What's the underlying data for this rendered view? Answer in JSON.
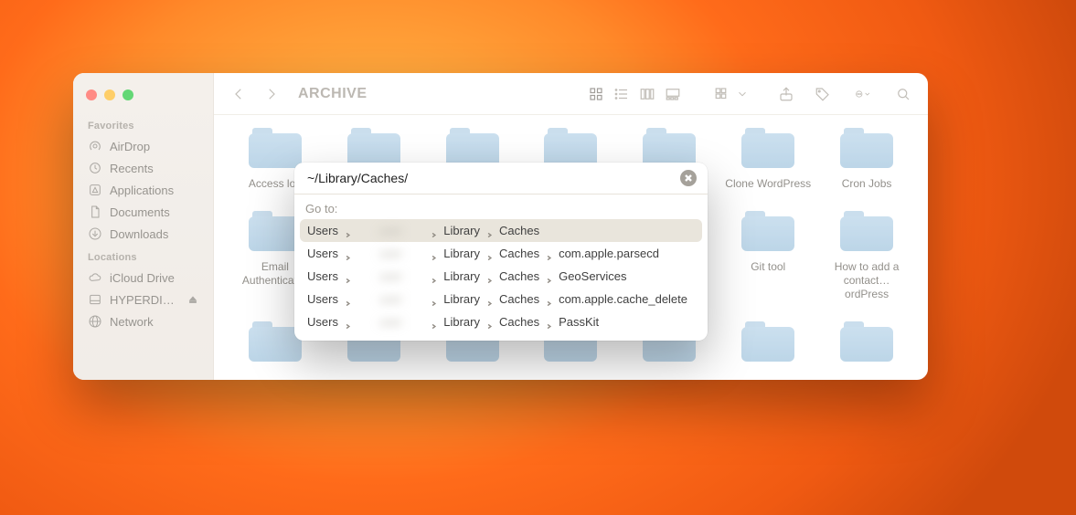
{
  "window": {
    "title": "ARCHIVE"
  },
  "sidebar": {
    "favorites_label": "Favorites",
    "favorites": [
      {
        "label": "AirDrop",
        "icon": "airdrop"
      },
      {
        "label": "Recents",
        "icon": "clock"
      },
      {
        "label": "Applications",
        "icon": "apps"
      },
      {
        "label": "Documents",
        "icon": "doc"
      },
      {
        "label": "Downloads",
        "icon": "download"
      }
    ],
    "locations_label": "Locations",
    "locations": [
      {
        "label": "iCloud Drive",
        "icon": "cloud",
        "eject": false
      },
      {
        "label": "HYPERDIS…",
        "icon": "disk",
        "eject": true
      },
      {
        "label": "Network",
        "icon": "network",
        "eject": false
      }
    ]
  },
  "folders": [
    "Access log",
    "",
    "",
    "",
    "",
    "Clone WordPress",
    "Cron Jobs",
    "Email\nAuthenticat…",
    "",
    "",
    "",
    "",
    "Git tool",
    "How to add a\ncontact…ordPress",
    "",
    "",
    "",
    "",
    "",
    "",
    ""
  ],
  "goto": {
    "input_value": "~/Library/Caches/",
    "label": "Go to:",
    "suggestions": [
      {
        "segments": [
          "Users",
          "",
          "Library",
          "Caches"
        ],
        "blurred_index": 1,
        "selected": true
      },
      {
        "segments": [
          "Users",
          "",
          "Library",
          "Caches",
          "com.apple.parsecd"
        ],
        "blurred_index": 1
      },
      {
        "segments": [
          "Users",
          "",
          "Library",
          "Caches",
          "GeoServices"
        ],
        "blurred_index": 1
      },
      {
        "segments": [
          "Users",
          "",
          "Library",
          "Caches",
          "com.apple.cache_delete"
        ],
        "blurred_index": 1
      },
      {
        "segments": [
          "Users",
          "",
          "Library",
          "Caches",
          "PassKit"
        ],
        "blurred_index": 1
      }
    ]
  }
}
